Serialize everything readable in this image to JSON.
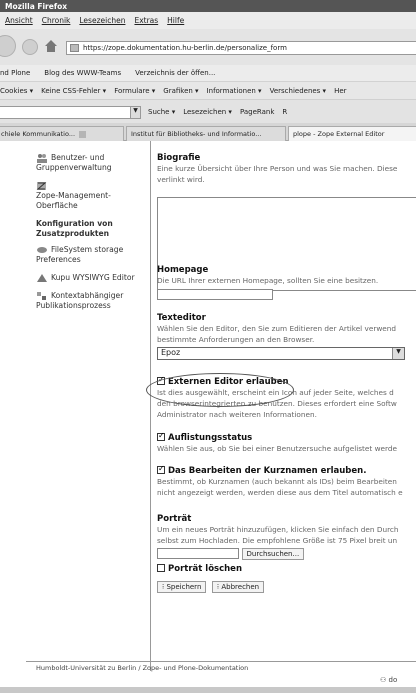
{
  "window": {
    "title": "Mozilla Firefox"
  },
  "menu": [
    "Ansicht",
    "Chronik",
    "Lesezeichen",
    "Extras",
    "Hilfe"
  ],
  "url": "https://zope.dokumentation.hu-berlin.de/personalize_form",
  "bookmarks": [
    "nd Plone",
    "Blog des WWW-Teams",
    "Verzeichnis der öffen..."
  ],
  "webdev": [
    "Cookies ▾",
    "Keine CSS-Fehler ▾",
    "Formulare ▾",
    "Grafiken ▾",
    "Informationen ▾",
    "Verschiedenes ▾",
    "Her"
  ],
  "search": {
    "label": "Suche ▾",
    "bookmarks": "Lesezeichen ▾",
    "pagerank": "PageRank",
    "extra": "R"
  },
  "tabs": [
    {
      "label": "chiele Kommunikatio..."
    },
    {
      "label": "Institut für Bibliotheks- und Informatio..."
    },
    {
      "label": "plope - Zope External Editor"
    }
  ],
  "sidebar": {
    "users": "Benutzer- und Gruppenverwaltung",
    "zmi": "Zope-Management-Oberfläche",
    "config_heading": "Konfiguration von Zusatzprodukten",
    "filesystem": "FileSystem storage Preferences",
    "kupu": "Kupu WYSIWYG Editor",
    "context": "Kontextabhängiger Publikationsprozess"
  },
  "form": {
    "bio_label": "Biografie",
    "bio_help1": "Eine kurze Übersicht über Ihre Person und was Sie machen. Diese",
    "bio_help2": "verlinkt wird.",
    "homepage_label": "Homepage",
    "homepage_help": "Die URL Ihrer externen Homepage, sollten Sie eine besitzen.",
    "editor_label": "Texteditor",
    "editor_help1": "Wählen Sie den Editor, den Sie zum Editieren der Artikel verwend",
    "editor_help2": "bestimmte Anforderungen an den Browser.",
    "editor_value": "Epoz",
    "ext_label": "Externen Editor erlauben",
    "ext_help1": "Ist dies ausgewählt, erscheint ein Icon auf jeder Seite, welches d",
    "ext_help2": "den browserintegrierten zu benutzen. Dieses erfordert eine Softw",
    "ext_help3": "Administrator nach weiteren Informationen.",
    "listed_label": "Auflistungsstatus",
    "listed_help": "Wählen Sie aus, ob Sie bei einer Benutzersuche aufgelistet werde",
    "shortname_label": "Das Bearbeiten der Kurznamen erlauben.",
    "shortname_help1": "Bestimmt, ob Kurznamen (auch bekannt als IDs) beim Bearbeiten",
    "shortname_help2": "nicht angezeigt werden, werden diese aus dem Titel automatisch e",
    "portrait_label": "Porträt",
    "portrait_help1": "Um ein neues Porträt hinzuzufügen, klicken Sie einfach den Durch",
    "portrait_help2": "selbst zum Hochladen. Die empfohlene Größe ist 75 Pixel breit un",
    "browse_label": "Durchsuchen...",
    "delete_portrait_label": "Porträt löschen",
    "save_label": "Speichern",
    "cancel_label": "Abbrechen"
  },
  "footer": "Humboldt-Universität zu Berlin / Zope- und Plone-Dokumentation",
  "status": "do"
}
